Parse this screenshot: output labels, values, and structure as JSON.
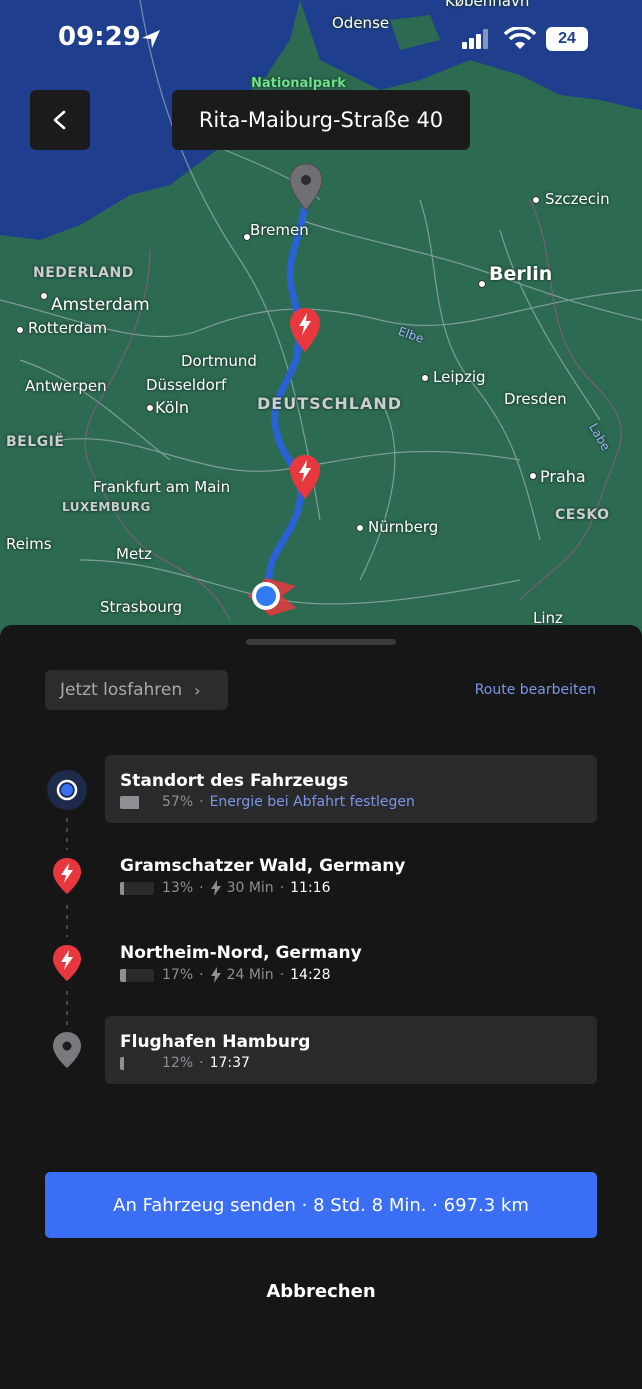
{
  "status_bar": {
    "time": "09:29",
    "battery": "24"
  },
  "header": {
    "title": "Rita-Maiburg-Straße 40"
  },
  "map": {
    "labels": {
      "odense": "Odense",
      "kobenhavn": "København",
      "nationalpark": "Nationalpark",
      "szczecin": "Szczecin",
      "bremen": "Bremen",
      "berlin": "Berlin",
      "nederland": "NEDERLAND",
      "amsterdam": "Amsterdam",
      "rotterdam": "Rotterdam",
      "elbe": "Elbe",
      "dortmund": "Dortmund",
      "leipzig": "Leipzig",
      "antwerpen": "Antwerpen",
      "dusseldorf": "Düsseldorf",
      "deutschland": "DEUTSCHLAND",
      "dresden": "Dresden",
      "koln": "Köln",
      "belgie": "BELGIË",
      "labe": "Labe",
      "praha": "Praha",
      "frankfurt": "Frankfurt am Main",
      "luxemburg": "LUXEMBURG",
      "cesko": "CESKO",
      "nurnberg": "Nürnberg",
      "reims": "Reims",
      "metz": "Metz",
      "strasbourg": "Strasbourg",
      "linz": "Linz"
    },
    "colors": {
      "water": "#1f3f8e",
      "land": "#2c6a51",
      "route": "#2a62d6",
      "charger": "#e8383d"
    }
  },
  "sheet": {
    "start_button": "Jetzt losfahren",
    "edit_route": "Route bearbeiten",
    "stops": [
      {
        "name": "Standort des Fahrzeugs",
        "battery": "57%",
        "battery_level": 0.57,
        "extra": "Energie bei Abfahrt festlegen",
        "icon": "vehicle-location-icon"
      },
      {
        "name": "Gramschatzer Wald, Germany",
        "battery": "13%",
        "battery_level": 0.13,
        "charge_time": "30 Min",
        "eta": "11:16",
        "icon": "charger-pin-icon"
      },
      {
        "name": "Northeim-Nord, Germany",
        "battery": "17%",
        "battery_level": 0.17,
        "charge_time": "24 Min",
        "eta": "14:28",
        "icon": "charger-pin-icon"
      },
      {
        "name": "Flughafen Hamburg",
        "battery": "12%",
        "battery_level": 0.12,
        "eta": "17:37",
        "icon": "destination-pin-icon"
      }
    ],
    "send_button": "An Fahrzeug senden · 8 Std. 8 Min. · 697.3 km",
    "cancel": "Abbrechen"
  }
}
